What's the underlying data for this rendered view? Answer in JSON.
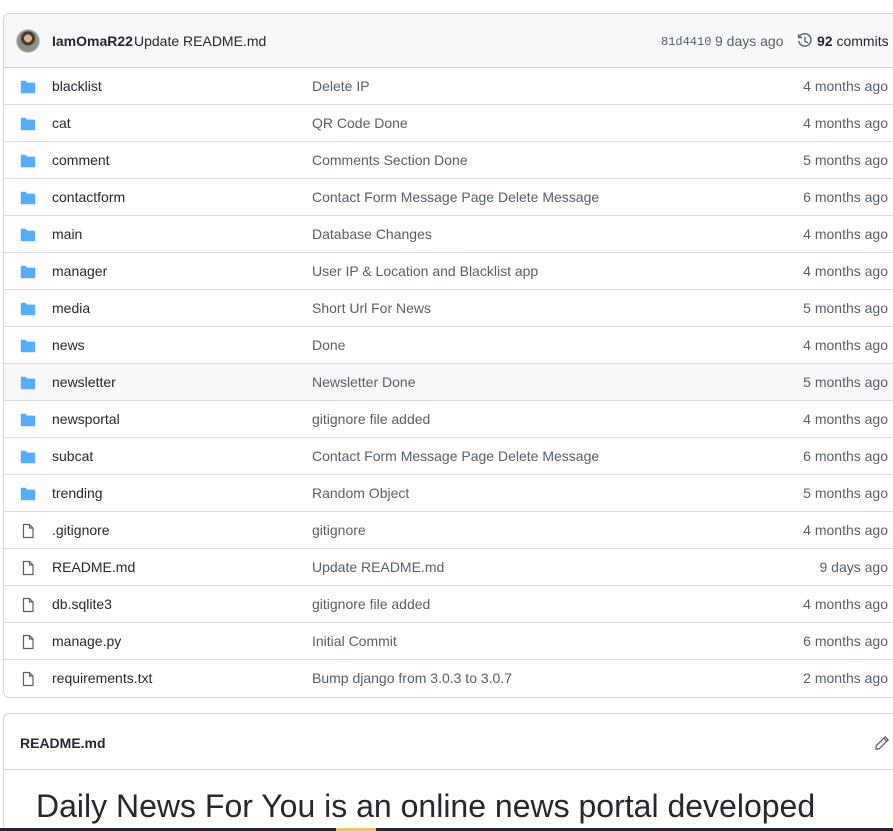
{
  "commit": {
    "author": "IamOmaR22",
    "message": "Update README.md",
    "sha": "81d4410",
    "time_ago": "9 days ago",
    "commits_count": "92",
    "commits_label": "commits"
  },
  "files": [
    {
      "type": "folder",
      "name": "blacklist",
      "message": "Delete IP",
      "age": "4 months ago"
    },
    {
      "type": "folder",
      "name": "cat",
      "message": "QR Code Done",
      "age": "4 months ago"
    },
    {
      "type": "folder",
      "name": "comment",
      "message": "Comments Section Done",
      "age": "5 months ago"
    },
    {
      "type": "folder",
      "name": "contactform",
      "message": "Contact Form Message Page Delete Message",
      "age": "6 months ago"
    },
    {
      "type": "folder",
      "name": "main",
      "message": "Database Changes",
      "age": "4 months ago"
    },
    {
      "type": "folder",
      "name": "manager",
      "message": "User IP & Location and Blacklist app",
      "age": "4 months ago"
    },
    {
      "type": "folder",
      "name": "media",
      "message": "Short Url For News",
      "age": "5 months ago"
    },
    {
      "type": "folder",
      "name": "news",
      "message": "Done",
      "age": "4 months ago"
    },
    {
      "type": "folder",
      "name": "newsletter",
      "message": "Newsletter Done",
      "age": "5 months ago"
    },
    {
      "type": "folder",
      "name": "newsportal",
      "message": "gitignore file added",
      "age": "4 months ago"
    },
    {
      "type": "folder",
      "name": "subcat",
      "message": "Contact Form Message Page Delete Message",
      "age": "6 months ago"
    },
    {
      "type": "folder",
      "name": "trending",
      "message": "Random Object",
      "age": "5 months ago"
    },
    {
      "type": "file",
      "name": ".gitignore",
      "message": "gitignore",
      "age": "4 months ago"
    },
    {
      "type": "file",
      "name": "README.md",
      "message": "Update README.md",
      "age": "9 days ago"
    },
    {
      "type": "file",
      "name": "db.sqlite3",
      "message": "gitignore file added",
      "age": "4 months ago"
    },
    {
      "type": "file",
      "name": "manage.py",
      "message": "Initial Commit",
      "age": "6 months ago"
    },
    {
      "type": "file",
      "name": "requirements.txt",
      "message": "Bump django from 3.0.3 to 3.0.7",
      "age": "2 months ago"
    }
  ],
  "readme": {
    "filename": "README.md",
    "heading": "Daily News For You is an online news portal developed"
  },
  "colors": {
    "folder": "#54aeff",
    "file_icon": "#57606a",
    "border": "#d0d7de",
    "header_bg": "#f6f8fa"
  }
}
